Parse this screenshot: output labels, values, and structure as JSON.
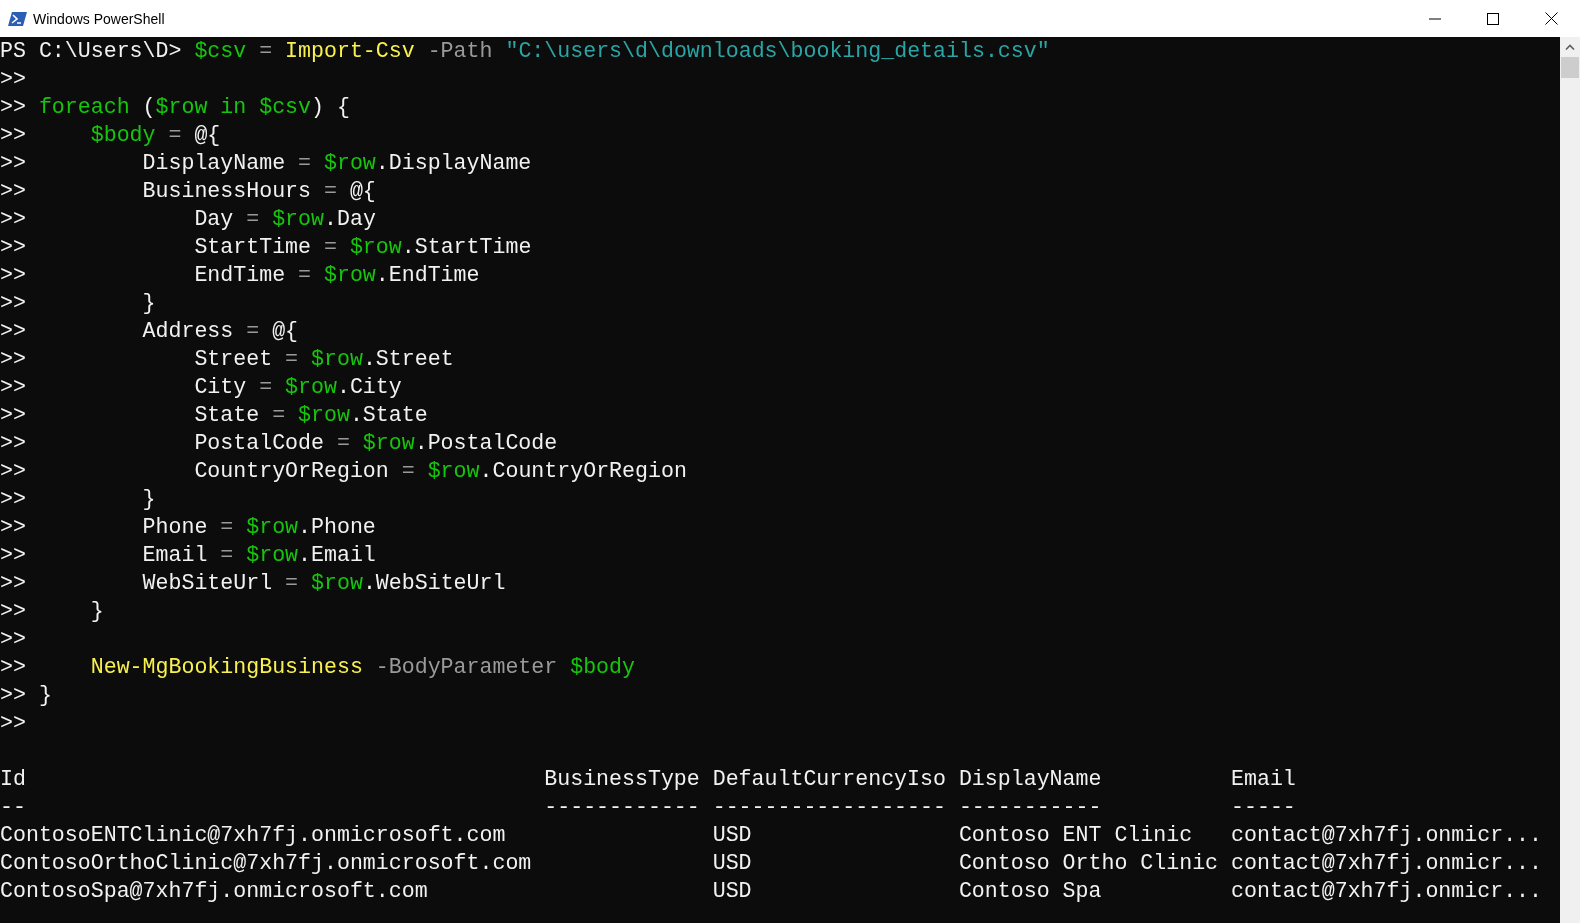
{
  "window": {
    "title": "Windows PowerShell"
  },
  "console": {
    "lines": [
      {
        "prompt": "PS C:\\Users\\D>",
        "tokens": [
          {
            "kind": "variable",
            "text": "$csv"
          },
          {
            "kind": "operator",
            "text": " = "
          },
          {
            "kind": "command",
            "text": "Import-Csv"
          },
          {
            "kind": "parameter",
            "text": " -Path "
          },
          {
            "kind": "string",
            "text": "\"C:\\users\\d\\downloads\\booking_details.csv\""
          }
        ]
      },
      {
        "prompt": ">>"
      },
      {
        "prompt": ">>",
        "tokens": [
          {
            "kind": "keyword",
            "text": "foreach"
          },
          {
            "kind": "plain",
            "text": " ("
          },
          {
            "kind": "variable",
            "text": "$row"
          },
          {
            "kind": "keyword",
            "text": " in "
          },
          {
            "kind": "variable",
            "text": "$csv"
          },
          {
            "kind": "plain",
            "text": ") {"
          }
        ]
      },
      {
        "prompt": ">>",
        "tokens": [
          {
            "kind": "variable",
            "text": "    $body"
          },
          {
            "kind": "operator",
            "text": " = "
          },
          {
            "kind": "plain",
            "text": "@{"
          }
        ]
      },
      {
        "prompt": ">>",
        "tokens": [
          {
            "kind": "plain",
            "text": "        DisplayName"
          },
          {
            "kind": "operator",
            "text": " = "
          },
          {
            "kind": "variable",
            "text": "$row"
          },
          {
            "kind": "plain",
            "text": ".DisplayName"
          }
        ]
      },
      {
        "prompt": ">>",
        "tokens": [
          {
            "kind": "plain",
            "text": "        BusinessHours"
          },
          {
            "kind": "operator",
            "text": " = "
          },
          {
            "kind": "plain",
            "text": "@{"
          }
        ]
      },
      {
        "prompt": ">>",
        "tokens": [
          {
            "kind": "plain",
            "text": "            Day"
          },
          {
            "kind": "operator",
            "text": " = "
          },
          {
            "kind": "variable",
            "text": "$row"
          },
          {
            "kind": "plain",
            "text": ".Day"
          }
        ]
      },
      {
        "prompt": ">>",
        "tokens": [
          {
            "kind": "plain",
            "text": "            StartTime"
          },
          {
            "kind": "operator",
            "text": " = "
          },
          {
            "kind": "variable",
            "text": "$row"
          },
          {
            "kind": "plain",
            "text": ".StartTime"
          }
        ]
      },
      {
        "prompt": ">>",
        "tokens": [
          {
            "kind": "plain",
            "text": "            EndTime"
          },
          {
            "kind": "operator",
            "text": " = "
          },
          {
            "kind": "variable",
            "text": "$row"
          },
          {
            "kind": "plain",
            "text": ".EndTime"
          }
        ]
      },
      {
        "prompt": ">>",
        "tokens": [
          {
            "kind": "plain",
            "text": "        }"
          }
        ]
      },
      {
        "prompt": ">>",
        "tokens": [
          {
            "kind": "plain",
            "text": "        Address"
          },
          {
            "kind": "operator",
            "text": " = "
          },
          {
            "kind": "plain",
            "text": "@{"
          }
        ]
      },
      {
        "prompt": ">>",
        "tokens": [
          {
            "kind": "plain",
            "text": "            Street"
          },
          {
            "kind": "operator",
            "text": " = "
          },
          {
            "kind": "variable",
            "text": "$row"
          },
          {
            "kind": "plain",
            "text": ".Street"
          }
        ]
      },
      {
        "prompt": ">>",
        "tokens": [
          {
            "kind": "plain",
            "text": "            City"
          },
          {
            "kind": "operator",
            "text": " = "
          },
          {
            "kind": "variable",
            "text": "$row"
          },
          {
            "kind": "plain",
            "text": ".City"
          }
        ]
      },
      {
        "prompt": ">>",
        "tokens": [
          {
            "kind": "plain",
            "text": "            State"
          },
          {
            "kind": "operator",
            "text": " = "
          },
          {
            "kind": "variable",
            "text": "$row"
          },
          {
            "kind": "plain",
            "text": ".State"
          }
        ]
      },
      {
        "prompt": ">>",
        "tokens": [
          {
            "kind": "plain",
            "text": "            PostalCode"
          },
          {
            "kind": "operator",
            "text": " = "
          },
          {
            "kind": "variable",
            "text": "$row"
          },
          {
            "kind": "plain",
            "text": ".PostalCode"
          }
        ]
      },
      {
        "prompt": ">>",
        "tokens": [
          {
            "kind": "plain",
            "text": "            CountryOrRegion"
          },
          {
            "kind": "operator",
            "text": " = "
          },
          {
            "kind": "variable",
            "text": "$row"
          },
          {
            "kind": "plain",
            "text": ".CountryOrRegion"
          }
        ]
      },
      {
        "prompt": ">>",
        "tokens": [
          {
            "kind": "plain",
            "text": "        }"
          }
        ]
      },
      {
        "prompt": ">>",
        "tokens": [
          {
            "kind": "plain",
            "text": "        Phone"
          },
          {
            "kind": "operator",
            "text": " = "
          },
          {
            "kind": "variable",
            "text": "$row"
          },
          {
            "kind": "plain",
            "text": ".Phone"
          }
        ]
      },
      {
        "prompt": ">>",
        "tokens": [
          {
            "kind": "plain",
            "text": "        Email"
          },
          {
            "kind": "operator",
            "text": " = "
          },
          {
            "kind": "variable",
            "text": "$row"
          },
          {
            "kind": "plain",
            "text": ".Email"
          }
        ]
      },
      {
        "prompt": ">>",
        "tokens": [
          {
            "kind": "plain",
            "text": "        WebSiteUrl"
          },
          {
            "kind": "operator",
            "text": " = "
          },
          {
            "kind": "variable",
            "text": "$row"
          },
          {
            "kind": "plain",
            "text": ".WebSiteUrl"
          }
        ]
      },
      {
        "prompt": ">>",
        "tokens": [
          {
            "kind": "plain",
            "text": "    }"
          }
        ]
      },
      {
        "prompt": ">>"
      },
      {
        "prompt": ">>",
        "tokens": [
          {
            "kind": "command",
            "text": "    New-MgBookingBusiness"
          },
          {
            "kind": "parameter",
            "text": " -BodyParameter "
          },
          {
            "kind": "variable",
            "text": "$body"
          }
        ]
      },
      {
        "prompt": ">>",
        "tokens": [
          {
            "kind": "plain",
            "text": "}"
          }
        ]
      },
      {
        "prompt": ">>"
      }
    ]
  },
  "table": {
    "columns": [
      {
        "heading": "Id",
        "underline": "--"
      },
      {
        "heading": "BusinessType",
        "underline": "------------"
      },
      {
        "heading": "DefaultCurrencyIso",
        "underline": "------------------"
      },
      {
        "heading": "DisplayName",
        "underline": "-----------"
      },
      {
        "heading": "Email",
        "underline": "-----"
      }
    ],
    "rows": [
      {
        "id": "ContosoENTClinic@7xh7fj.onmicrosoft.com",
        "default_currency_iso": "USD",
        "display_name": "Contoso ENT Clinic",
        "email": "contact@7xh7fj.onmicr..."
      },
      {
        "id": "ContosoOrthoClinic@7xh7fj.onmicrosoft.com",
        "default_currency_iso": "USD",
        "display_name": "Contoso Ortho Clinic",
        "email": "contact@7xh7fj.onmicr..."
      },
      {
        "id": "ContosoSpa@7xh7fj.onmicrosoft.com",
        "default_currency_iso": "USD",
        "display_name": "Contoso Spa",
        "email": "contact@7xh7fj.onmicr..."
      }
    ]
  }
}
